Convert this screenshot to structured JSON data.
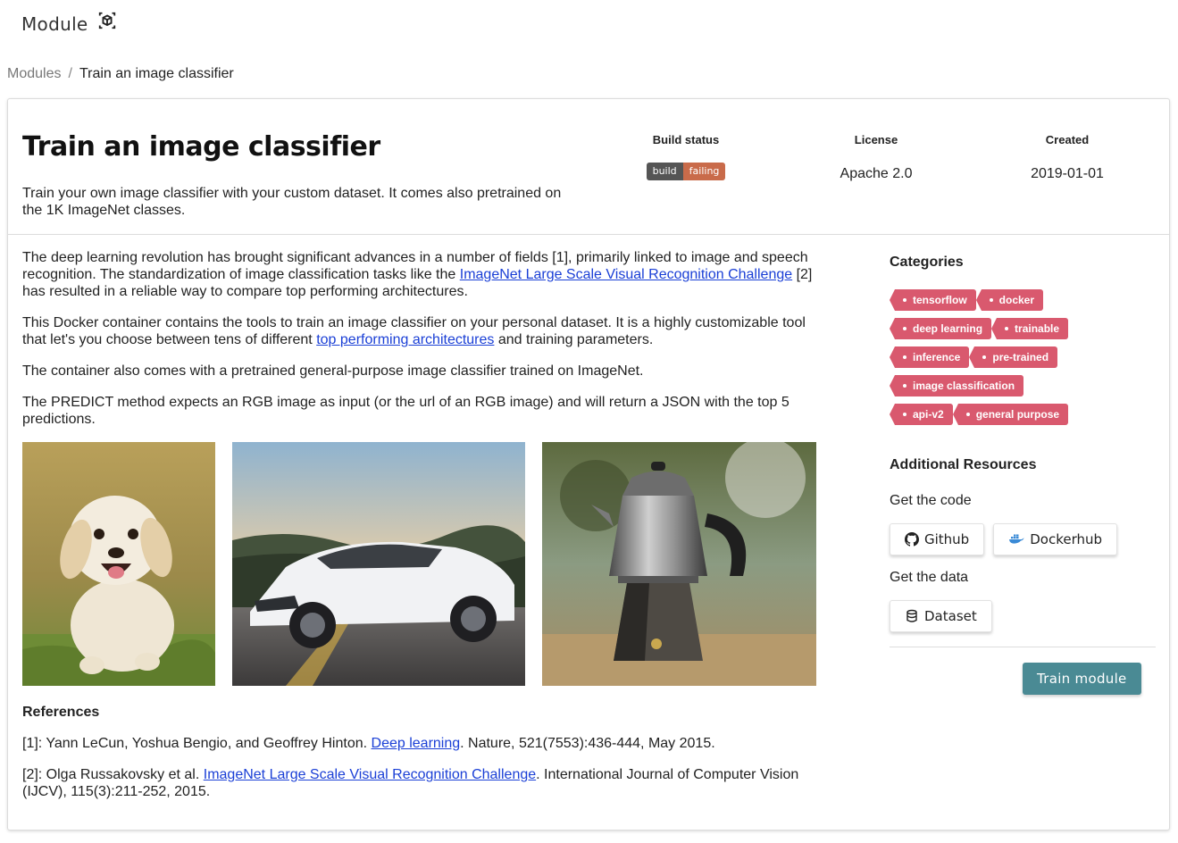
{
  "app": {
    "title": "Module",
    "logo_icon": "cube-icon"
  },
  "breadcrumb": {
    "root": "Modules",
    "separator": "/",
    "current": "Train an image classifier"
  },
  "header": {
    "title": "Train an image classifier",
    "description": "Train your own image classifier with your custom dataset. It comes also pretrained on the 1K ImageNet classes.",
    "build_label": "Build status",
    "build_badge_left": "build",
    "build_badge_right": "failing",
    "license_label": "License",
    "license_value": "Apache 2.0",
    "created_label": "Created",
    "created_value": "2019-01-01"
  },
  "description": {
    "p1_a": "The deep learning revolution has brought significant advances in a number of fields [1], primarily linked to image and speech recognition. The standardization of image classification tasks like the ",
    "p1_link": "ImageNet Large Scale Visual Recognition Challenge",
    "p1_b": " [2] has resulted in a reliable way to compare top performing architectures.",
    "p2_a": "This Docker container contains the tools to train an image classifier on your personal dataset. It is a highly customizable tool that let's you choose between tens of different ",
    "p2_link": "top performing architectures",
    "p2_b": " and training parameters.",
    "p3": "The container also comes with a pretrained general-purpose image classifier trained on ImageNet.",
    "p4": "The PREDICT method expects an RGB image as input (or the url of an RGB image) and will return a JSON with the top 5 predictions."
  },
  "references": {
    "title": "References",
    "r1_a": "[1]: Yann LeCun, Yoshua Bengio, and Geoffrey Hinton. ",
    "r1_link": "Deep learning",
    "r1_b": ". Nature, 521(7553):436-444, May 2015.",
    "r2_a": "[2]: Olga Russakovsky et al. ",
    "r2_link": "ImageNet Large Scale Visual Recognition Challenge",
    "r2_b": ". International Journal of Computer Vision (IJCV), 115(3):211-252, 2015."
  },
  "sidebar": {
    "categories_title": "Categories",
    "tags": [
      "tensorflow",
      "docker",
      "deep learning",
      "trainable",
      "inference",
      "pre-trained",
      "image classification",
      "api-v2",
      "general purpose"
    ],
    "resources_title": "Additional Resources",
    "code_label": "Get the code",
    "github_label": "Github",
    "dockerhub_label": "Dockerhub",
    "data_label": "Get the data",
    "dataset_label": "Dataset",
    "train_label": "Train module"
  },
  "colors": {
    "tag": "#d9596e",
    "train_button": "#4a8a94",
    "badge_fail": "#c96b4a",
    "link": "#1a3fd6"
  }
}
